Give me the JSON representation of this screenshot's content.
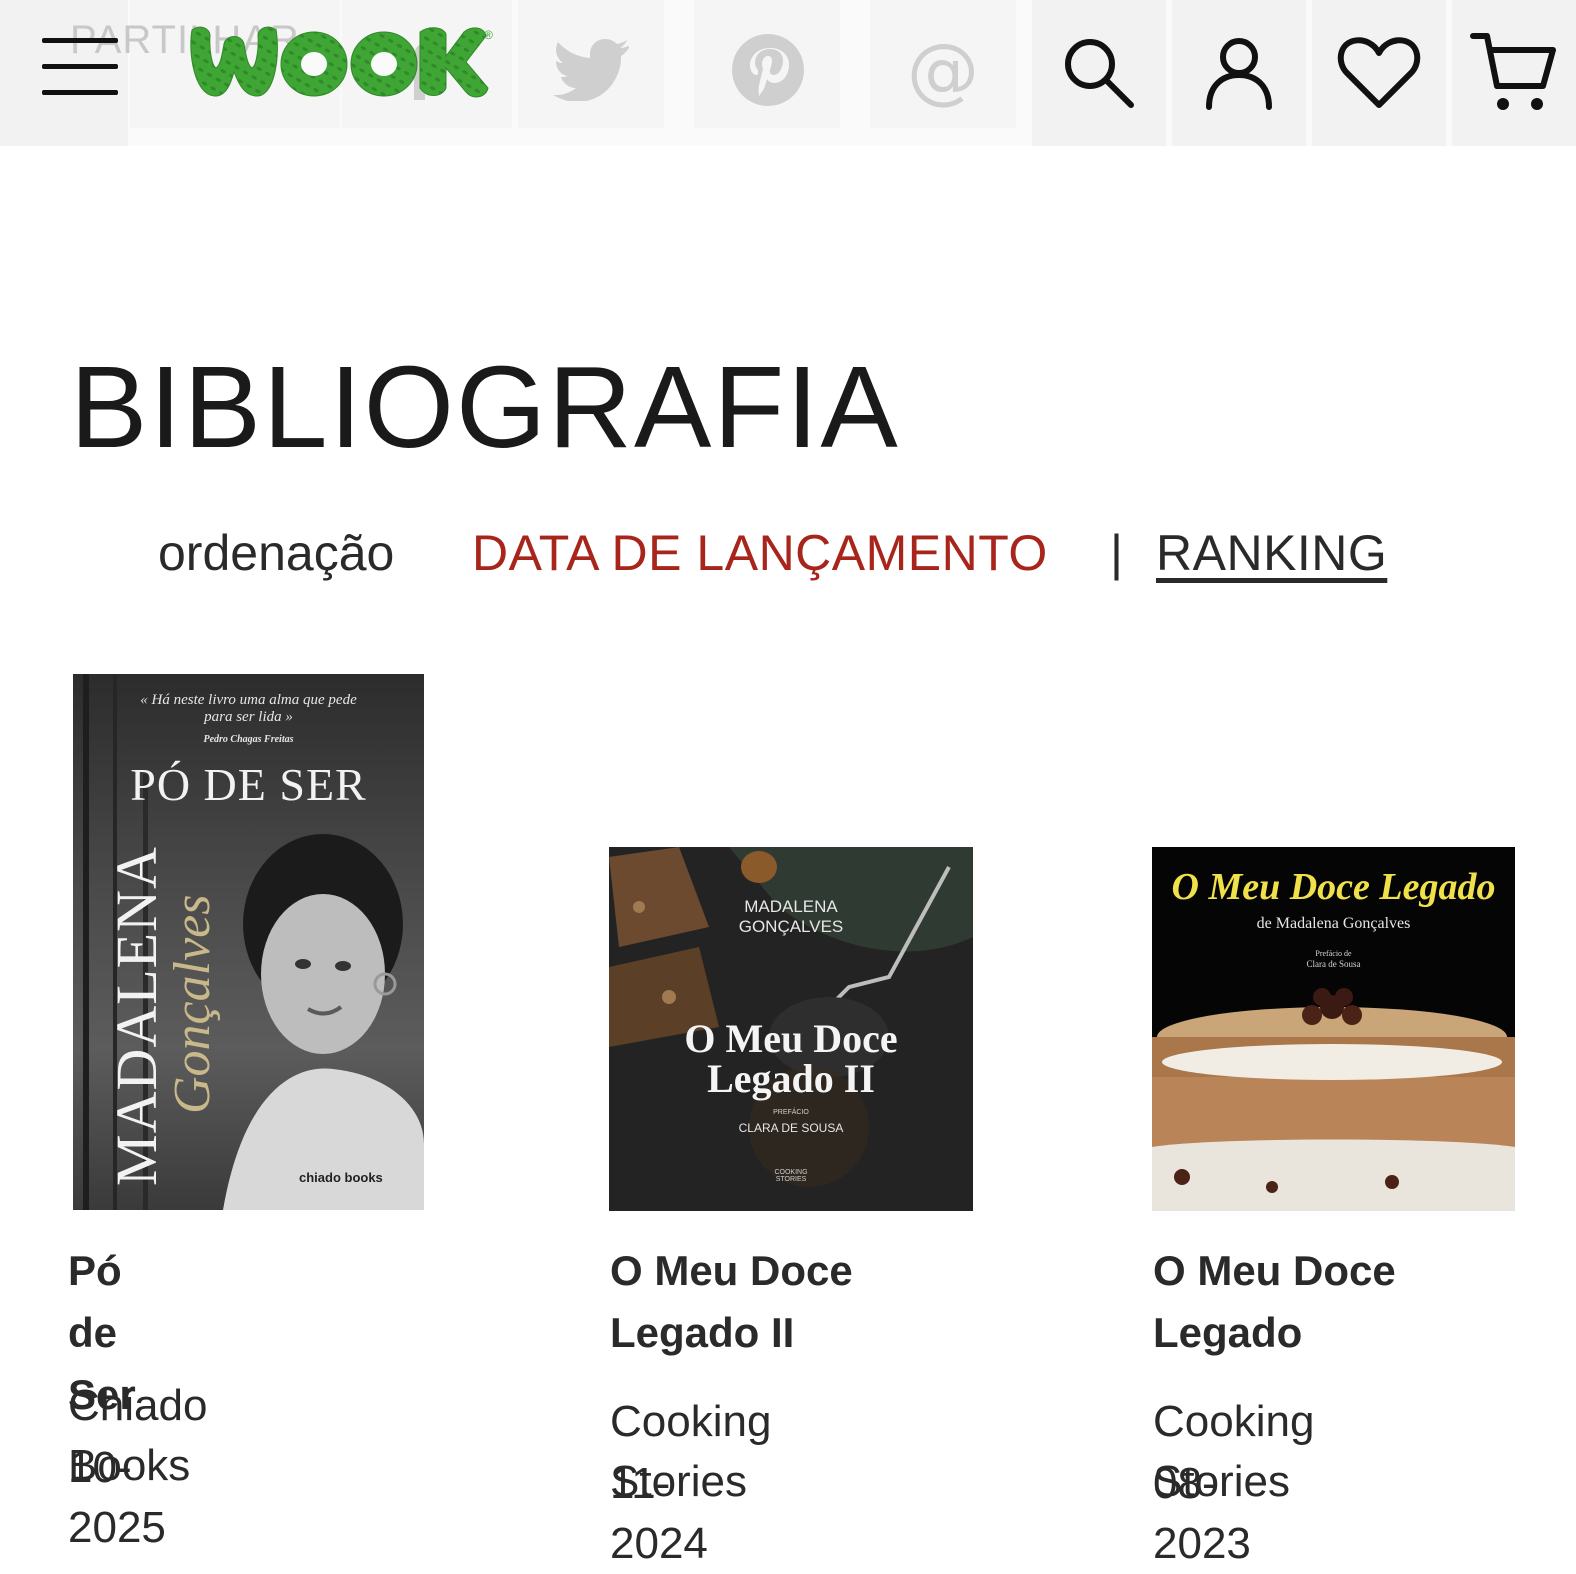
{
  "header": {
    "share_label": "PARTILHAR",
    "logo_text": "WOOK",
    "logo_mark": "®",
    "icons": {
      "menu": "hamburger-icon",
      "facebook": "facebook-icon",
      "twitter": "twitter-icon",
      "pinterest": "pinterest-icon",
      "email": "at-icon",
      "search": "search-icon",
      "account": "user-icon",
      "wishlist": "heart-icon",
      "cart": "cart-icon"
    },
    "email_symbol": "@",
    "brand_color": "#3fa535"
  },
  "page": {
    "title": "BIBLIOGRAFIA"
  },
  "sort": {
    "label": "ordenação",
    "active": "DATA DE LANÇAMENTO",
    "separator": "|",
    "other": "RANKING",
    "active_color": "#a8251c"
  },
  "books": [
    {
      "title": "Pó de Ser",
      "publisher": "Chiado Books",
      "date": "10-2025",
      "cover": {
        "quote": "« Há neste livro uma alma que pede para ser lida »",
        "quote_author": "Pedro Chagas Freitas",
        "title": "PÓ DE SER",
        "author_first": "MADALENA",
        "author_last": "Gonçalves",
        "publisher_mark": "chiado books"
      }
    },
    {
      "title": "O Meu Doce Legado II",
      "publisher": "Cooking Stories",
      "date": "11-2024",
      "cover": {
        "author": "MADALENA GONÇALVES",
        "title": "O Meu Doce Legado II",
        "preface_label": "PREFÁCIO",
        "preface_author": "CLARA DE SOUSA",
        "publisher_mark": "COOKING STORIES"
      }
    },
    {
      "title": "O Meu Doce Legado",
      "publisher": "Cooking Stories",
      "date": "08-2023",
      "cover": {
        "title": "O Meu Doce Legado",
        "author": "de Madalena Gonçalves",
        "preface_label": "Prefácio de",
        "preface_author": "Clara de Sousa"
      }
    }
  ]
}
